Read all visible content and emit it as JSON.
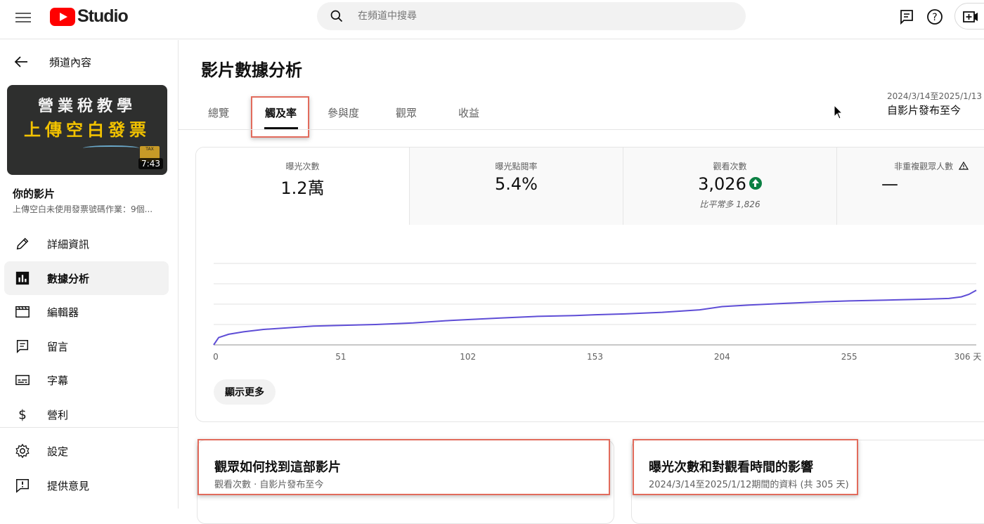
{
  "header": {
    "logo_text": "Studio",
    "search_placeholder": "在頻道中搜尋"
  },
  "sidebar": {
    "back_label": "頻道內容",
    "thumbnail": {
      "line1": "營業稅教學",
      "line2": "上傳空白發票",
      "badge": "TAX",
      "duration": "7:43"
    },
    "your_video_label": "你的影片",
    "video_title": "上傳空白未使用發票號碼作業：9個...",
    "items": [
      {
        "label": "詳細資訊",
        "icon": "pencil-icon"
      },
      {
        "label": "數據分析",
        "icon": "analytics-icon",
        "active": true
      },
      {
        "label": "編輯器",
        "icon": "clapper-icon"
      },
      {
        "label": "留言",
        "icon": "comment-icon"
      },
      {
        "label": "字幕",
        "icon": "subtitles-icon"
      },
      {
        "label": "營利",
        "icon": "dollar-icon"
      }
    ],
    "bottom_items": [
      {
        "label": "設定",
        "icon": "gear-icon"
      },
      {
        "label": "提供意見",
        "icon": "feedback-icon"
      }
    ]
  },
  "main": {
    "title": "影片數據分析",
    "tabs": [
      "總覽",
      "觸及率",
      "參與度",
      "觀眾",
      "收益"
    ],
    "active_tab": "觸及率",
    "date_range": "2024/3/14至2025/1/13",
    "date_label": "自影片發布至今",
    "metrics": [
      {
        "label": "曝光次數",
        "value": "1.2萬",
        "note": ""
      },
      {
        "label": "曝光點閱率",
        "value": "5.4%",
        "note": ""
      },
      {
        "label": "觀看次數",
        "value": "3,026",
        "note": "比平常多 1,826"
      },
      {
        "label": "非重複觀眾人數",
        "value": "—",
        "note": ""
      }
    ],
    "show_more": "顯示更多",
    "cards": [
      {
        "title": "觀眾如何找到這部影片",
        "subtitle": "觀看次數 · 自影片發布至今"
      },
      {
        "title": "曝光次數和對觀看時間的影響",
        "subtitle": "2024/3/14至2025/1/12期間的資料 (共 305 天)"
      }
    ]
  },
  "chart_data": {
    "type": "line",
    "x_ticks": [
      "0",
      "51",
      "102",
      "153",
      "204",
      "255",
      "306 天"
    ],
    "xlim": [
      0,
      306
    ],
    "x": [
      0,
      2,
      6,
      12,
      20,
      30,
      40,
      51,
      65,
      80,
      95,
      102,
      115,
      130,
      145,
      153,
      165,
      180,
      195,
      204,
      215,
      230,
      245,
      255,
      270,
      285,
      295,
      300,
      303,
      306
    ],
    "y": [
      0.0,
      0.09,
      0.13,
      0.16,
      0.19,
      0.21,
      0.23,
      0.24,
      0.25,
      0.27,
      0.3,
      0.31,
      0.33,
      0.35,
      0.36,
      0.37,
      0.38,
      0.4,
      0.43,
      0.47,
      0.49,
      0.51,
      0.53,
      0.54,
      0.55,
      0.56,
      0.57,
      0.59,
      0.62,
      0.67
    ],
    "ylim": [
      0,
      1
    ],
    "gridlines": 4,
    "color": "#5e4dd6"
  }
}
